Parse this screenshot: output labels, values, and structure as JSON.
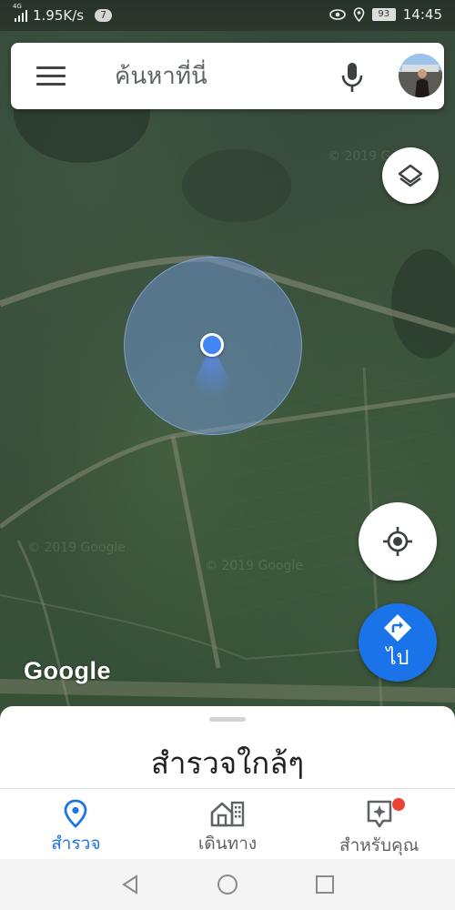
{
  "status_bar": {
    "network_type": "4G",
    "speed": "1.95K/s",
    "notification_count": "7",
    "battery": "93",
    "time": "14:45"
  },
  "search": {
    "placeholder": "ค้นหาที่นี่"
  },
  "map": {
    "watermark": "© 2019 Google",
    "attribution": "Google"
  },
  "buttons": {
    "go_label": "ไป"
  },
  "sheet": {
    "title": "สำรวจใกล้ๆ"
  },
  "bottom_nav": {
    "items": [
      {
        "label": "สำรวจ",
        "icon": "location-pin-icon",
        "active": true
      },
      {
        "label": "เดินทาง",
        "icon": "commute-icon",
        "active": false
      },
      {
        "label": "สำหรับคุณ",
        "icon": "for-you-icon",
        "active": false,
        "badge": true
      }
    ]
  },
  "colors": {
    "accent": "#1a73e8",
    "location_dot": "#4285f4",
    "notification": "#ea4335"
  }
}
